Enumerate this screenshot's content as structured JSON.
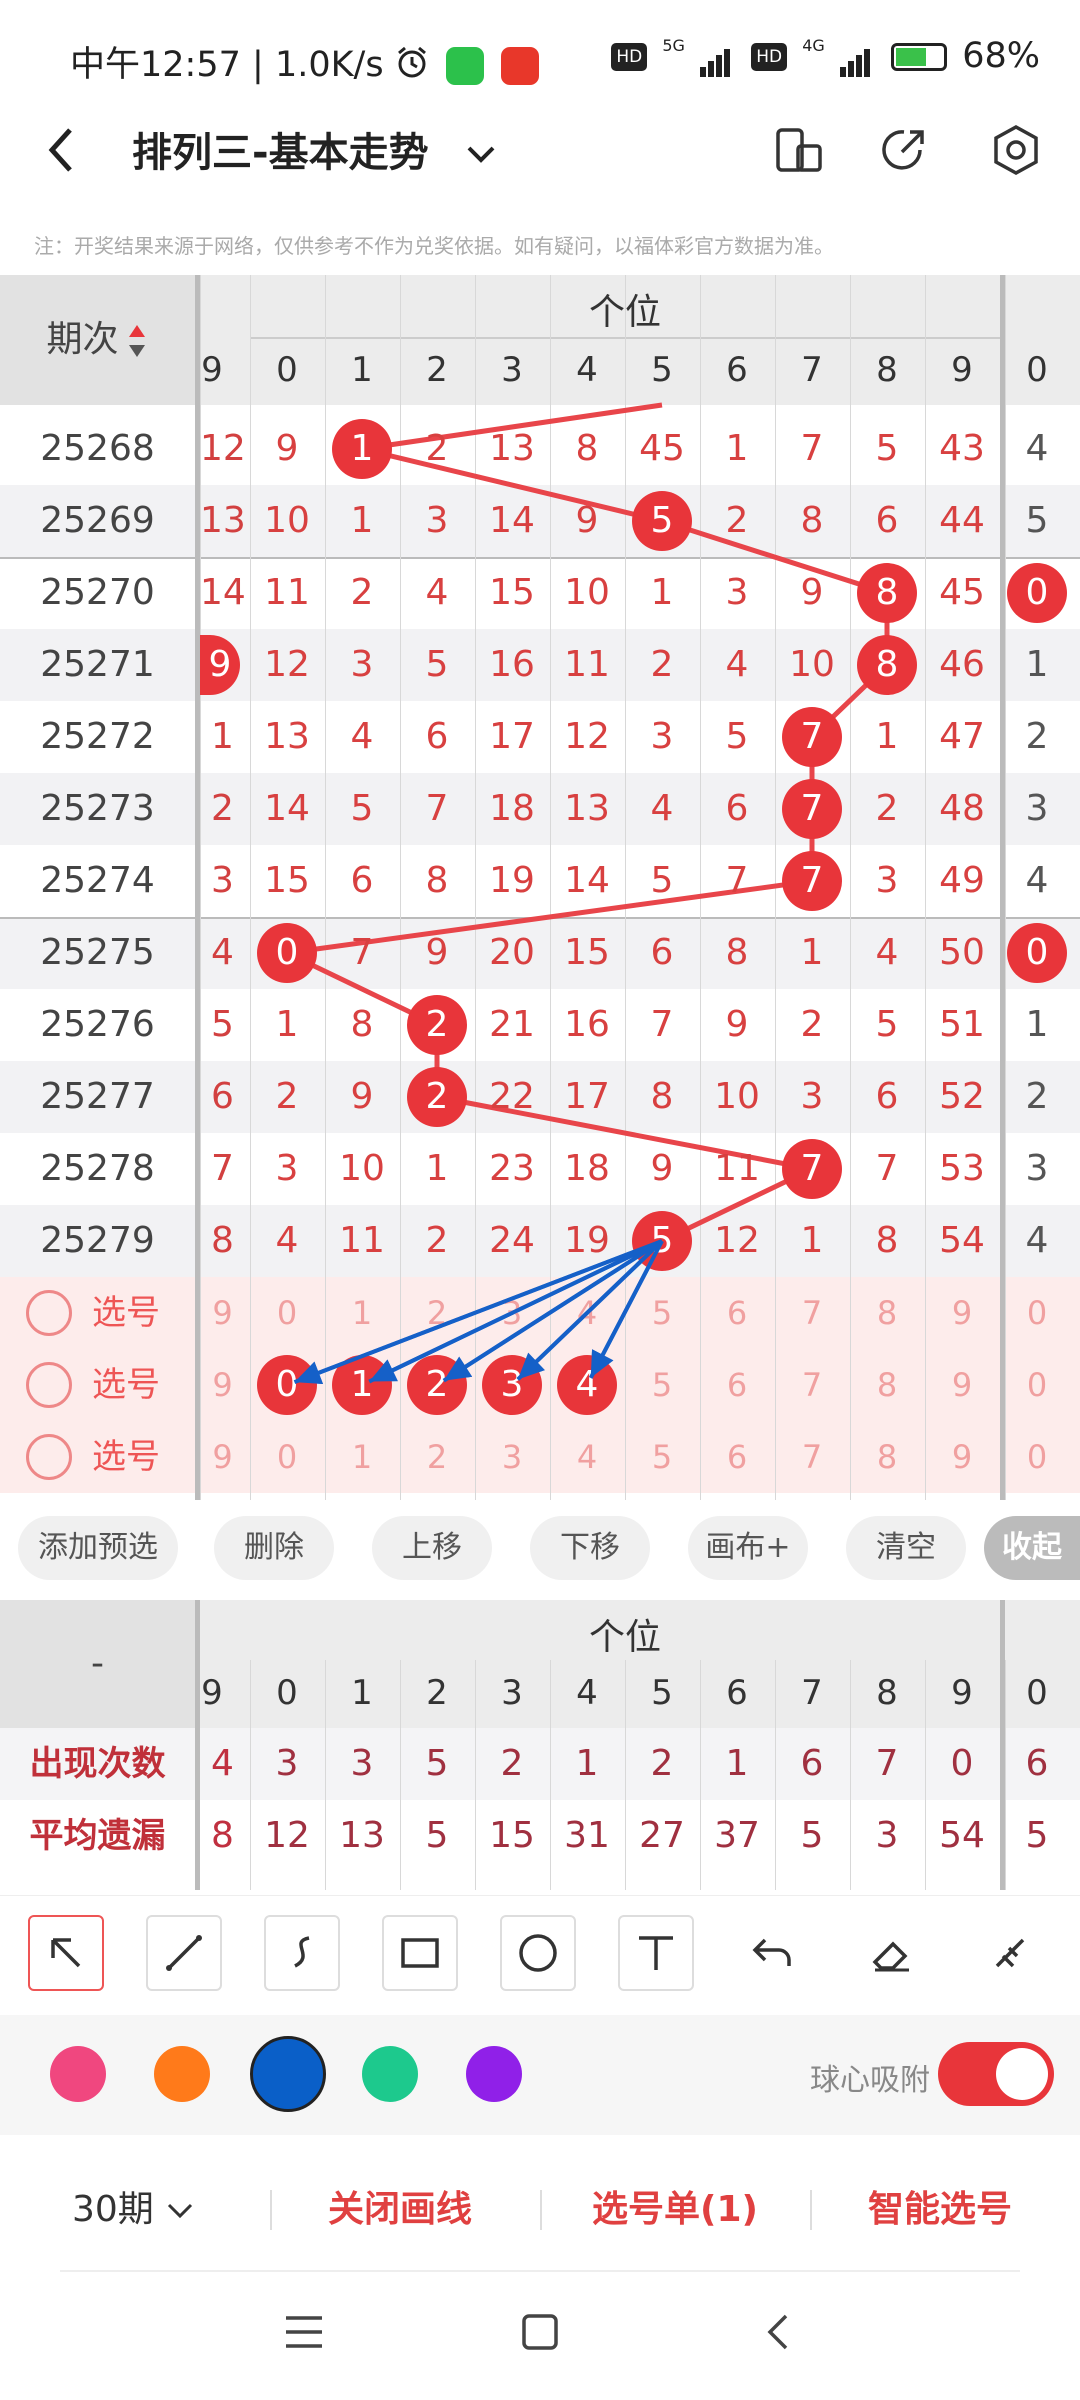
{
  "status": {
    "time": "中午12:57",
    "speed": "1.0K/s",
    "net1": "5G",
    "net2": "4G",
    "battery": "68%"
  },
  "header": {
    "title": "排列三-基本走势"
  },
  "notice": "注：开奖结果来源于网络，仅供参考不作为兑奖依据。如有疑问，以福体彩官方数据为准。",
  "chart": {
    "period_header": "期次",
    "group_label": "个位",
    "col_headers": [
      "9",
      "0",
      "1",
      "2",
      "3",
      "4",
      "5",
      "6",
      "7",
      "8",
      "9",
      "0"
    ],
    "rows": [
      {
        "period": "25268",
        "cells": [
          "12",
          "9",
          "1",
          "2",
          "13",
          "8",
          "45",
          "1",
          "7",
          "5",
          "43",
          "4"
        ],
        "hit": 2,
        "lhit": false,
        "rhit": false
      },
      {
        "period": "25269",
        "cells": [
          "13",
          "10",
          "1",
          "3",
          "14",
          "9",
          "5",
          "2",
          "8",
          "6",
          "44",
          "5"
        ],
        "hit": 6,
        "lhit": false,
        "rhit": false
      },
      {
        "period": "25270",
        "cells": [
          "14",
          "11",
          "2",
          "4",
          "15",
          "10",
          "1",
          "3",
          "9",
          "8",
          "45",
          "0"
        ],
        "hit": 9,
        "lhit": false,
        "rhit": true
      },
      {
        "period": "25271",
        "cells": [
          "9",
          "12",
          "3",
          "5",
          "16",
          "11",
          "2",
          "4",
          "10",
          "8",
          "46",
          "1"
        ],
        "hit": 9,
        "lhit": true,
        "rhit": false
      },
      {
        "period": "25272",
        "cells": [
          "1",
          "13",
          "4",
          "6",
          "17",
          "12",
          "3",
          "5",
          "7",
          "1",
          "47",
          "2"
        ],
        "hit": 8,
        "lhit": false,
        "rhit": false
      },
      {
        "period": "25273",
        "cells": [
          "2",
          "14",
          "5",
          "7",
          "18",
          "13",
          "4",
          "6",
          "7",
          "2",
          "48",
          "3"
        ],
        "hit": 8,
        "lhit": false,
        "rhit": false
      },
      {
        "period": "25274",
        "cells": [
          "3",
          "15",
          "6",
          "8",
          "19",
          "14",
          "5",
          "7",
          "7",
          "3",
          "49",
          "4"
        ],
        "hit": 8,
        "lhit": false,
        "rhit": false
      },
      {
        "period": "25275",
        "cells": [
          "4",
          "0",
          "7",
          "9",
          "20",
          "15",
          "6",
          "8",
          "1",
          "4",
          "50",
          "0"
        ],
        "hit": 1,
        "lhit": false,
        "rhit": true
      },
      {
        "period": "25276",
        "cells": [
          "5",
          "1",
          "8",
          "2",
          "21",
          "16",
          "7",
          "9",
          "2",
          "5",
          "51",
          "1"
        ],
        "hit": 3,
        "lhit": false,
        "rhit": false
      },
      {
        "period": "25277",
        "cells": [
          "6",
          "2",
          "9",
          "2",
          "22",
          "17",
          "8",
          "10",
          "3",
          "6",
          "52",
          "2"
        ],
        "hit": 3,
        "lhit": false,
        "rhit": false
      },
      {
        "period": "25278",
        "cells": [
          "7",
          "3",
          "10",
          "1",
          "23",
          "18",
          "9",
          "11",
          "7",
          "7",
          "53",
          "3"
        ],
        "hit": 8,
        "lhit": false,
        "rhit": false
      },
      {
        "period": "25279",
        "cells": [
          "8",
          "4",
          "11",
          "2",
          "24",
          "19",
          "5",
          "12",
          "1",
          "8",
          "54",
          "4"
        ],
        "hit": 6,
        "lhit": false,
        "rhit": false
      }
    ],
    "pick_label": "选号",
    "pick_rows": [
      {
        "cells": [
          "9",
          "0",
          "1",
          "2",
          "3",
          "4",
          "5",
          "6",
          "7",
          "8",
          "9",
          "0"
        ],
        "balls": []
      },
      {
        "cells": [
          "9",
          "0",
          "1",
          "2",
          "3",
          "4",
          "5",
          "6",
          "7",
          "8",
          "9",
          "0"
        ],
        "balls": [
          1,
          2,
          3,
          4,
          5
        ]
      },
      {
        "cells": [
          "9",
          "0",
          "1",
          "2",
          "3",
          "4",
          "5",
          "6",
          "7",
          "8",
          "9",
          "0"
        ],
        "balls": []
      }
    ]
  },
  "actions": [
    "添加预选",
    "删除",
    "上移",
    "下移",
    "画布+",
    "清空",
    "收起"
  ],
  "stats": {
    "label_header": "-",
    "group_label": "个位",
    "col_headers": [
      "9",
      "0",
      "1",
      "2",
      "3",
      "4",
      "5",
      "6",
      "7",
      "8",
      "9",
      "0"
    ],
    "rows": [
      {
        "label": "出现次数",
        "cells": [
          "4",
          "3",
          "3",
          "5",
          "2",
          "1",
          "2",
          "1",
          "6",
          "7",
          "0",
          "6"
        ]
      },
      {
        "label": "平均遗漏",
        "cells": [
          "8",
          "12",
          "13",
          "5",
          "15",
          "31",
          "27",
          "37",
          "5",
          "3",
          "54",
          "5"
        ]
      }
    ]
  },
  "tools": [
    "arrow-tool-icon",
    "line-tool-icon",
    "curve-tool-icon",
    "rect-tool-icon",
    "circle-tool-icon",
    "text-tool-icon",
    "undo-icon",
    "eraser-icon",
    "clear-brush-icon"
  ],
  "colors": [
    "#f0477f",
    "#ff7a1a",
    "#0a5fc8",
    "#1dc98d",
    "#9020e8"
  ],
  "snap_label": "球心吸附",
  "bottom": {
    "period_select": "30期",
    "close_draw": "关闭画线",
    "pick_list": "选号单(1)",
    "smart_pick": "智能选号"
  }
}
